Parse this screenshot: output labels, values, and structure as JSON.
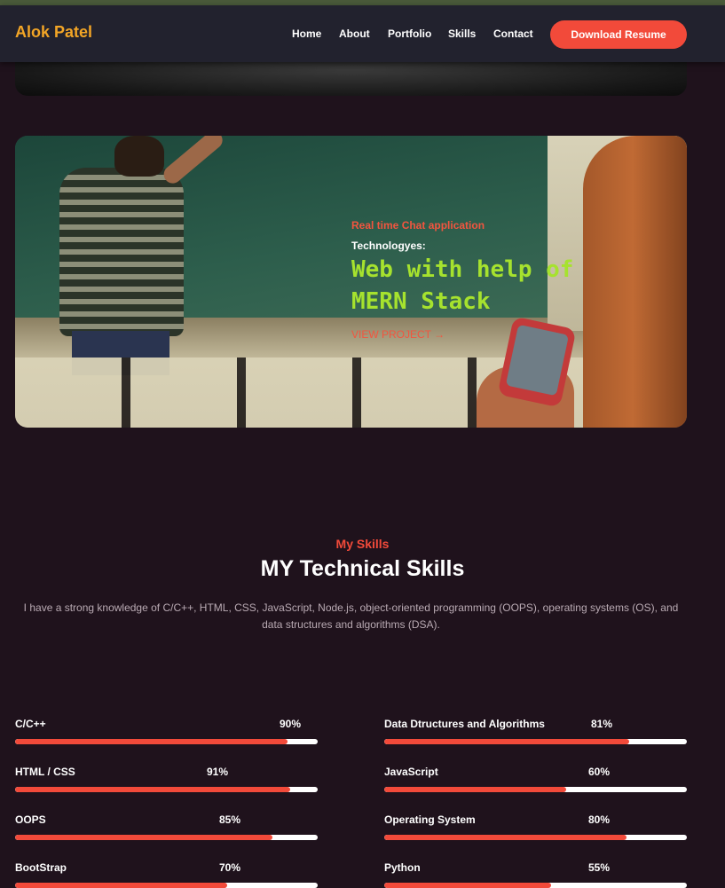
{
  "nav": {
    "brand": "Alok Patel",
    "links": [
      "Home",
      "About",
      "Portfolio",
      "Skills",
      "Contact"
    ],
    "cta": "Download Resume"
  },
  "project": {
    "subtitle": "Real time Chat application",
    "tech_label": "Technologyes:",
    "title_line1": "Web with help of",
    "title_line2": "MERN Stack",
    "link": "VIEW PROJECT →"
  },
  "skills": {
    "kicker": "My Skills",
    "title": "MY Technical Skills",
    "description": "I have a strong knowledge of C/C++, HTML, CSS, JavaScript, Node.js, object-oriented programming (OOPS), operating systems (OS), and data structures and algorithms (DSA).",
    "items": [
      {
        "name": "C/C++",
        "percent": "90%",
        "value": 90
      },
      {
        "name": "Data Dtructures and Algorithms",
        "percent": "81%",
        "value": 81
      },
      {
        "name": "HTML / CSS",
        "percent": "91%",
        "value": 91
      },
      {
        "name": "JavaScript",
        "percent": "60%",
        "value": 60
      },
      {
        "name": "OOPS",
        "percent": "85%",
        "value": 85
      },
      {
        "name": "Operating System",
        "percent": "80%",
        "value": 80
      },
      {
        "name": "BootStrap",
        "percent": "70%",
        "value": 70
      },
      {
        "name": "Python",
        "percent": "55%",
        "value": 55
      }
    ]
  },
  "colors": {
    "accent": "#f24a3a",
    "brand": "#f2a526",
    "project_title": "#a6e22e",
    "background": "#1f121c"
  }
}
